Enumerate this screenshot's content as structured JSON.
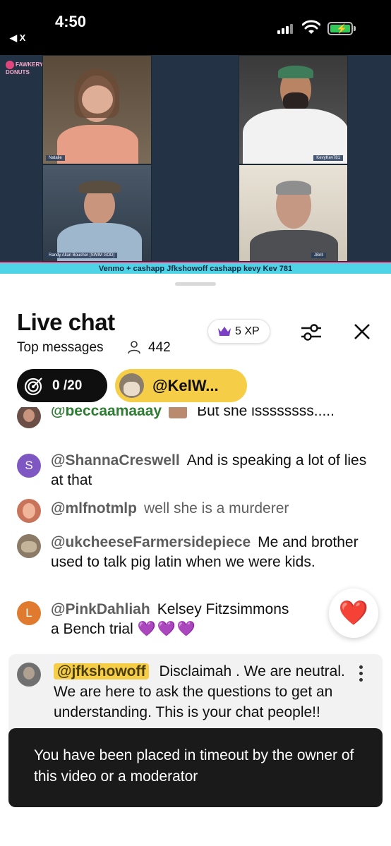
{
  "status_bar": {
    "time": "4:50",
    "back": "◀ X"
  },
  "video": {
    "logo_text": "FAWKERY DONUTS",
    "participants": [
      {
        "name": "Natalie"
      },
      {
        "name": "KevyKev781"
      },
      {
        "name": "Randy Allan Boucher (SWIM GOD)"
      },
      {
        "name": "JBrill"
      }
    ],
    "banner": "Venmo + cashapp Jfkshowoff cashapp kevy Kev 781"
  },
  "chat": {
    "title": "Live chat",
    "filter_label": "Top messages",
    "viewer_count": "442",
    "xp_label": "5 XP",
    "goal": "0 /20",
    "pinned_user": "@KelW...",
    "messages": [
      {
        "user": "@beccaamaaay",
        "text": "But she issssssss.....",
        "avatar_color": "#6b4f46"
      },
      {
        "user": "@ShannaCreswell",
        "text": "And is speaking a lot of lies at that",
        "avatar_letter": "S",
        "avatar_color": "#7e57c2"
      },
      {
        "user": "@mlfnotmlp",
        "text": "well she is a murderer",
        "avatar_color": "#c9735b"
      },
      {
        "user": "@ukcheeseFarmersidepiece",
        "text": "Me and brother used to talk pig latin when we were kids.",
        "avatar_color": "#8a7a66"
      },
      {
        "user": "@PinkDahliah",
        "text": "Kelsey Fitzsimmons",
        "text2": "a Bench trial",
        "hearts": "💜💜💜",
        "avatar_letter": "L",
        "avatar_color": "#e07a2e"
      }
    ],
    "highlighted": {
      "user": "@jfkshowoff",
      "text": "Disclaimah . We are neutral. We are here to ask the questions to get an understanding. This is your chat people!!"
    },
    "toast": "You have been placed in timeout by the owner of this video or a moderator",
    "heart": "❤️"
  }
}
